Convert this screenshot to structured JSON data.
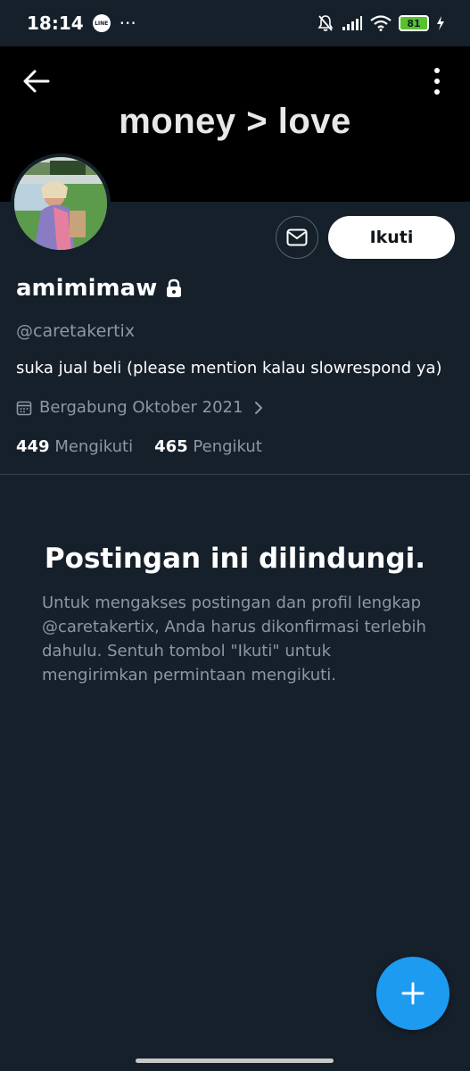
{
  "status_bar": {
    "time": "18:14",
    "line_badge": "LINE",
    "more_dots": "···",
    "battery": "81",
    "icons": [
      "bell-muted-icon",
      "signal-icon",
      "wifi-icon",
      "battery-icon",
      "charging-icon"
    ]
  },
  "banner": {
    "text": "money > love"
  },
  "profile": {
    "display_name": "amimimaw",
    "handle": "@caretakertix",
    "bio": "suka jual beli (please mention kalau slowrespond ya)",
    "joined": "Bergabung Oktober 2021",
    "following_count": "449",
    "following_label": "Mengikuti",
    "followers_count": "465",
    "followers_label": "Pengikut"
  },
  "actions": {
    "follow_label": "Ikuti"
  },
  "protected": {
    "title": "Postingan ini dilindungi.",
    "text": "Untuk mengakses postingan dan profil lengkap @caretakertix, Anda harus dikonfirmasi terlebih dahulu. Sentuh tombol \"Ikuti\" untuk mengirimkan permintaan mengikuti."
  },
  "colors": {
    "background": "#15202b",
    "accent": "#1d9bf0",
    "secondary_text": "#8b98a5",
    "divider": "#38444d"
  }
}
